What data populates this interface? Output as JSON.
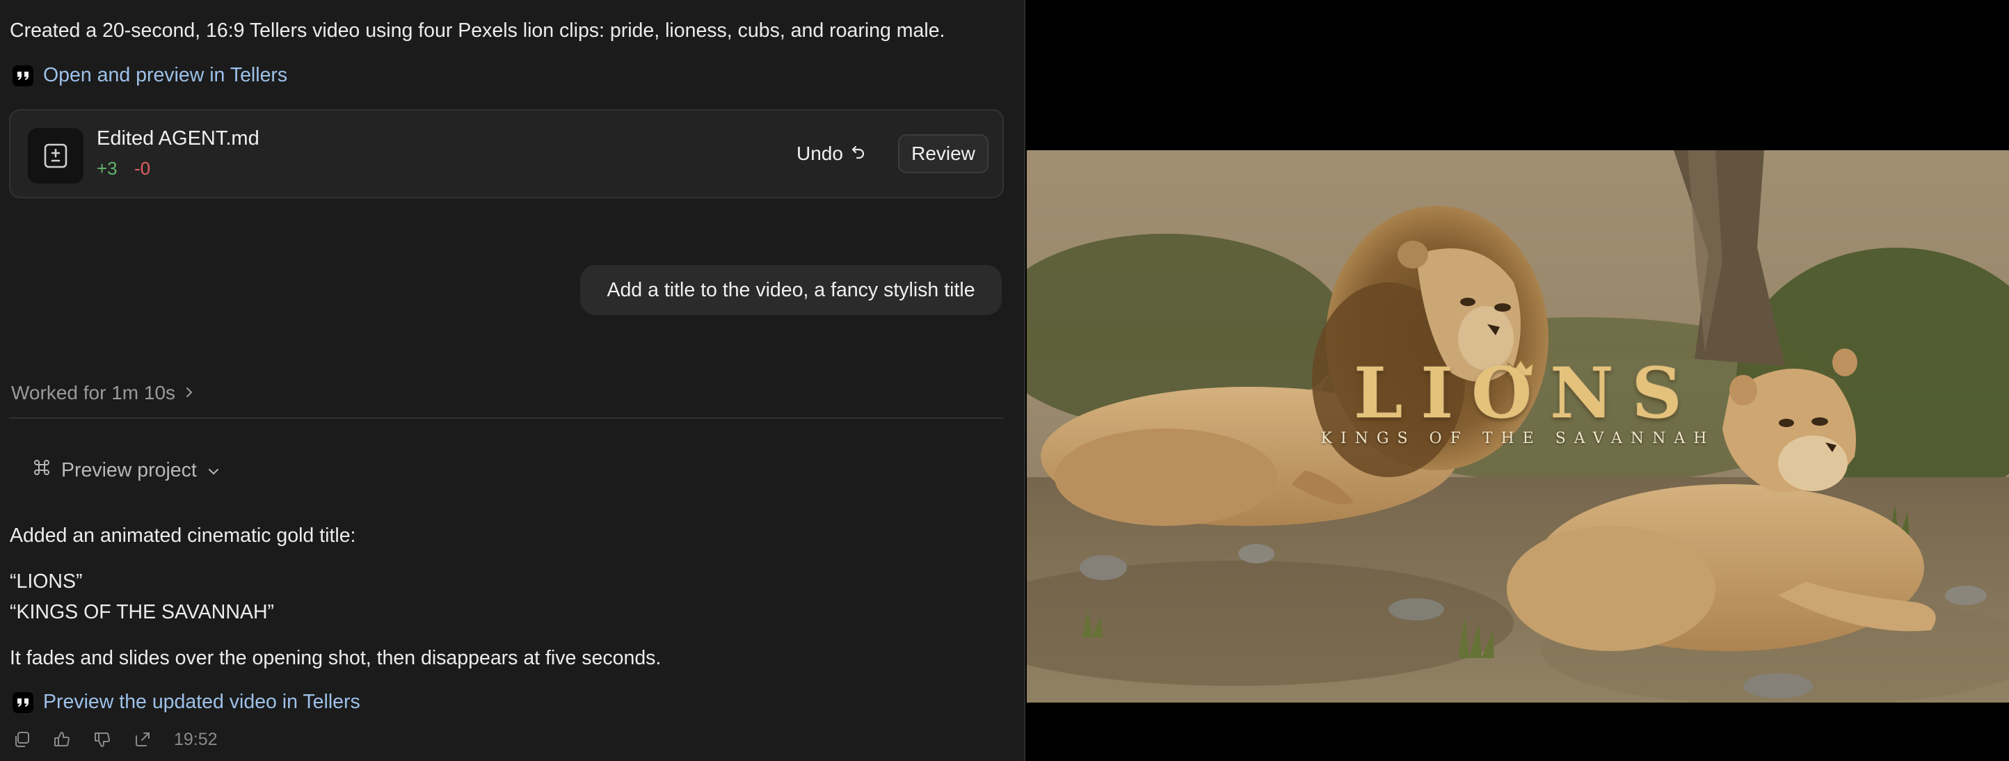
{
  "chat": {
    "summary_text": "Created a 20-second, 16:9 Tellers video using four Pexels lion clips: pride, lioness, cubs, and roaring male.",
    "open_link": {
      "icon": "quote-icon",
      "label": "Open and preview in Tellers"
    },
    "edit_card": {
      "icon": "diff-file-icon",
      "file_name": "Edited AGENT.md",
      "additions": "+3",
      "deletions": "-0",
      "undo_label": "Undo",
      "review_label": "Review"
    },
    "user_message": "Add a title to the video, a fancy stylish title",
    "worked_label": "Worked for 1m 10s",
    "preview_project_label": "Preview project",
    "response": {
      "line1": "Added an animated cinematic gold title:",
      "quote1": "“LIONS”",
      "quote2": "“KINGS OF THE SAVANNAH”",
      "line2": "It fades and slides over the opening shot, then disappears at five seconds."
    },
    "preview_link": {
      "icon": "quote-icon",
      "label": "Preview the updated video in Tellers"
    },
    "message_actions": {
      "icons": [
        "copy-icon",
        "thumbs-up-icon",
        "thumbs-down-icon",
        "share-icon"
      ],
      "timestamp": "19:52"
    }
  },
  "video": {
    "title": "LIONS",
    "subtitle": "KINGS OF THE SAVANNAH"
  },
  "colors": {
    "panel_bg": "#1b1b1b",
    "link": "#9dc1ea",
    "additions": "#5fb56a",
    "deletions": "#e06060",
    "title_gold": "#e4c27c"
  }
}
